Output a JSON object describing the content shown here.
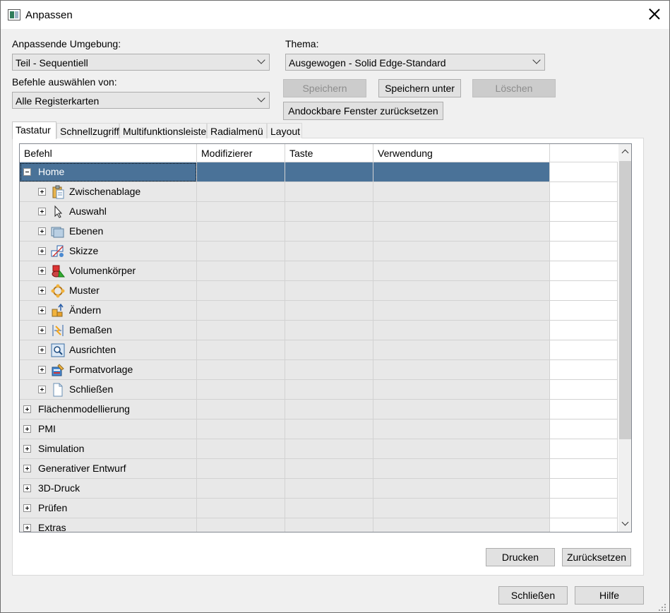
{
  "window": {
    "title": "Anpassen"
  },
  "environment": {
    "label": "Anpassende Umgebung:",
    "value": "Teil - Sequentiell"
  },
  "theme": {
    "label": "Thema:",
    "value": "Ausgewogen - Solid Edge-Standard"
  },
  "commands_from": {
    "label": "Befehle auswählen von:",
    "value": "Alle Registerkarten"
  },
  "buttons": {
    "save": "Speichern",
    "save_as": "Speichern unter",
    "delete": "Löschen",
    "reset_docking": "Andockbare Fenster zurücksetzen",
    "print": "Drucken",
    "reset": "Zurücksetzen",
    "close": "Schließen",
    "help": "Hilfe"
  },
  "tabs": [
    "Tastatur",
    "Schnellzugriff",
    "Multifunktionsleiste",
    "Radialmenü",
    "Layout"
  ],
  "table": {
    "columns": [
      "Befehl",
      "Modifizierer",
      "Taste",
      "Verwendung"
    ],
    "rows": [
      {
        "label": "Home",
        "level": 0,
        "expanded": true,
        "selected": true,
        "icon": ""
      },
      {
        "label": "Zwischenablage",
        "level": 1,
        "expanded": false,
        "icon": "clipboard-icon"
      },
      {
        "label": "Auswahl",
        "level": 1,
        "expanded": false,
        "icon": "select-arrow-icon"
      },
      {
        "label": "Ebenen",
        "level": 1,
        "expanded": false,
        "icon": "layers-icon"
      },
      {
        "label": "Skizze",
        "level": 1,
        "expanded": false,
        "icon": "sketch-icon"
      },
      {
        "label": "Volumenkörper",
        "level": 1,
        "expanded": false,
        "icon": "solid-body-icon"
      },
      {
        "label": "Muster",
        "level": 1,
        "expanded": false,
        "icon": "pattern-icon"
      },
      {
        "label": "Ändern",
        "level": 1,
        "expanded": false,
        "icon": "modify-icon"
      },
      {
        "label": "Bemaßen",
        "level": 1,
        "expanded": false,
        "icon": "dimension-icon"
      },
      {
        "label": "Ausrichten",
        "level": 1,
        "expanded": false,
        "icon": "align-icon"
      },
      {
        "label": "Formatvorlage",
        "level": 1,
        "expanded": false,
        "icon": "style-icon"
      },
      {
        "label": "Schließen",
        "level": 1,
        "expanded": false,
        "icon": "document-icon"
      },
      {
        "label": "Flächenmodellierung",
        "level": 0,
        "expanded": false,
        "icon": ""
      },
      {
        "label": "PMI",
        "level": 0,
        "expanded": false,
        "icon": ""
      },
      {
        "label": "Simulation",
        "level": 0,
        "expanded": false,
        "icon": ""
      },
      {
        "label": "Generativer Entwurf",
        "level": 0,
        "expanded": false,
        "icon": ""
      },
      {
        "label": "3D-Druck",
        "level": 0,
        "expanded": false,
        "icon": ""
      },
      {
        "label": "Prüfen",
        "level": 0,
        "expanded": false,
        "icon": ""
      },
      {
        "label": "Extras",
        "level": 0,
        "expanded": false,
        "icon": ""
      }
    ]
  },
  "colors": {
    "selection": "#4a7298",
    "cell": "#e8e8e8",
    "disabled_button": "#cccccc"
  }
}
